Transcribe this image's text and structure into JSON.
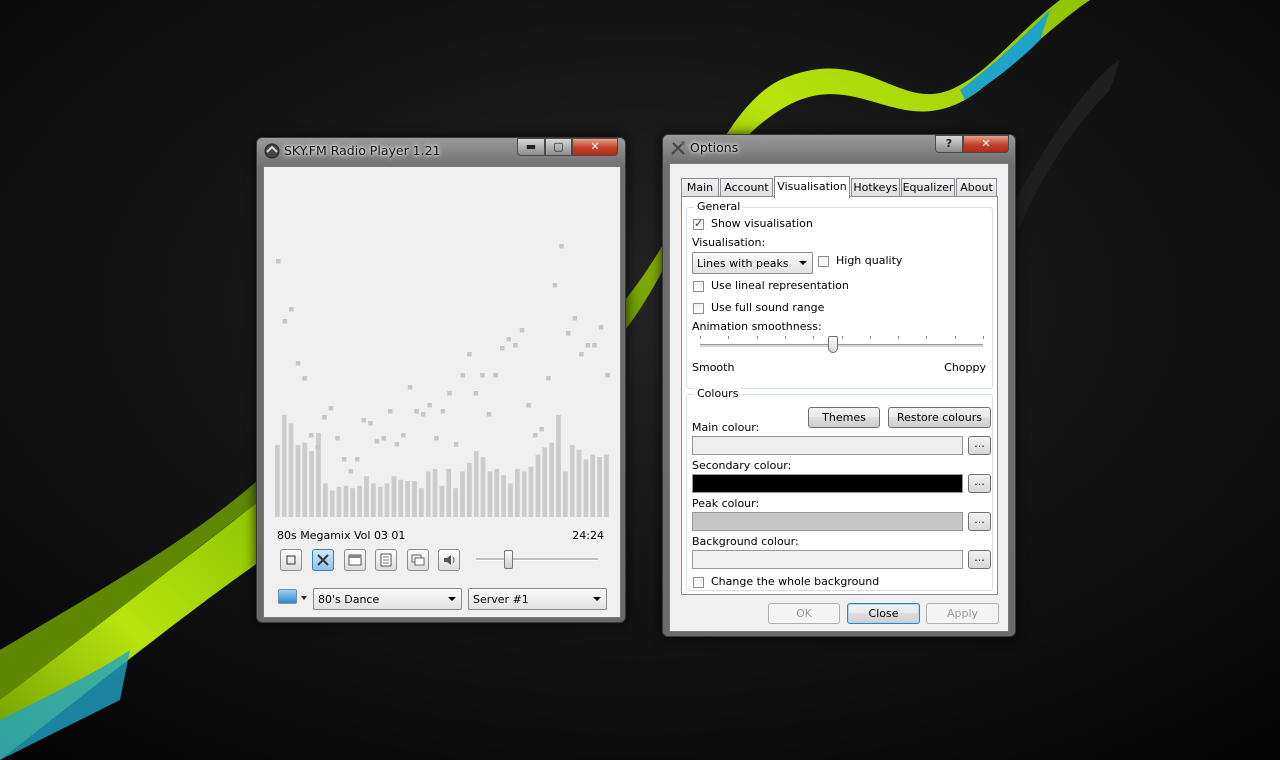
{
  "player": {
    "title": "SKY.FM Radio Player 1.21",
    "track_title": "80s Megamix Vol 03 01",
    "track_time": "24:24",
    "genre_select": "80's Dance",
    "server_select": "Server #1",
    "volume_level": 0.25,
    "controls": [
      "stop-icon",
      "settings-tools-icon",
      "calendar-icon",
      "playlist-icon",
      "chat-icon",
      "speaker-icon"
    ],
    "viz_bars": [
      60,
      85,
      78,
      60,
      62,
      55,
      70,
      28,
      22,
      25,
      26,
      24,
      26,
      34,
      28,
      25,
      28,
      34,
      31,
      30,
      30,
      24,
      38,
      40,
      26,
      40,
      24,
      38,
      45,
      55,
      50,
      38,
      40,
      35,
      28,
      40,
      38,
      42,
      52,
      58,
      62,
      85,
      38,
      60,
      56,
      48,
      52,
      50,
      52
    ],
    "viz_peaks": [
      86,
      66,
      70,
      52,
      47,
      28,
      24,
      34,
      37,
      27,
      20,
      16,
      20,
      33,
      32,
      26,
      27,
      36,
      25,
      28,
      44,
      36,
      35,
      38,
      27,
      36,
      42,
      25,
      48,
      55,
      42,
      48,
      35,
      48,
      57,
      60,
      58,
      63,
      38,
      28,
      30,
      47,
      78,
      91,
      62,
      67,
      55,
      58,
      58,
      64,
      48
    ]
  },
  "options": {
    "title": "Options",
    "help_button": "?",
    "tabs": [
      "Main",
      "Account",
      "Visualisation",
      "Hotkeys",
      "Equalizer",
      "About"
    ],
    "selected_tab": "Visualisation",
    "general": {
      "group_label": "General",
      "show_visualisation": "Show visualisation",
      "visualisation_label": "Visualisation:",
      "visualisation_value": "Lines with peaks",
      "high_quality": "High quality",
      "use_lineal": "Use lineal representation",
      "use_full_range": "Use full sound range",
      "smoothness_label": "Animation smoothness:",
      "smooth": "Smooth",
      "choppy": "Choppy",
      "smoothness_value": 0.47
    },
    "colours": {
      "group_label": "Colours",
      "themes_button": "Themes",
      "restore_button": "Restore colours",
      "main_label": "Main colour:",
      "main_color": "#eeeeee",
      "secondary_label": "Secondary colour:",
      "secondary_color": "#000000",
      "peak_label": "Peak colour:",
      "peak_color": "#c6c6c6",
      "background_label": "Background colour:",
      "background_color": "#f0f0f0",
      "browse_label": "...",
      "change_background": "Change the whole background"
    },
    "buttons": {
      "ok": "OK",
      "close": "Close",
      "apply": "Apply"
    }
  }
}
